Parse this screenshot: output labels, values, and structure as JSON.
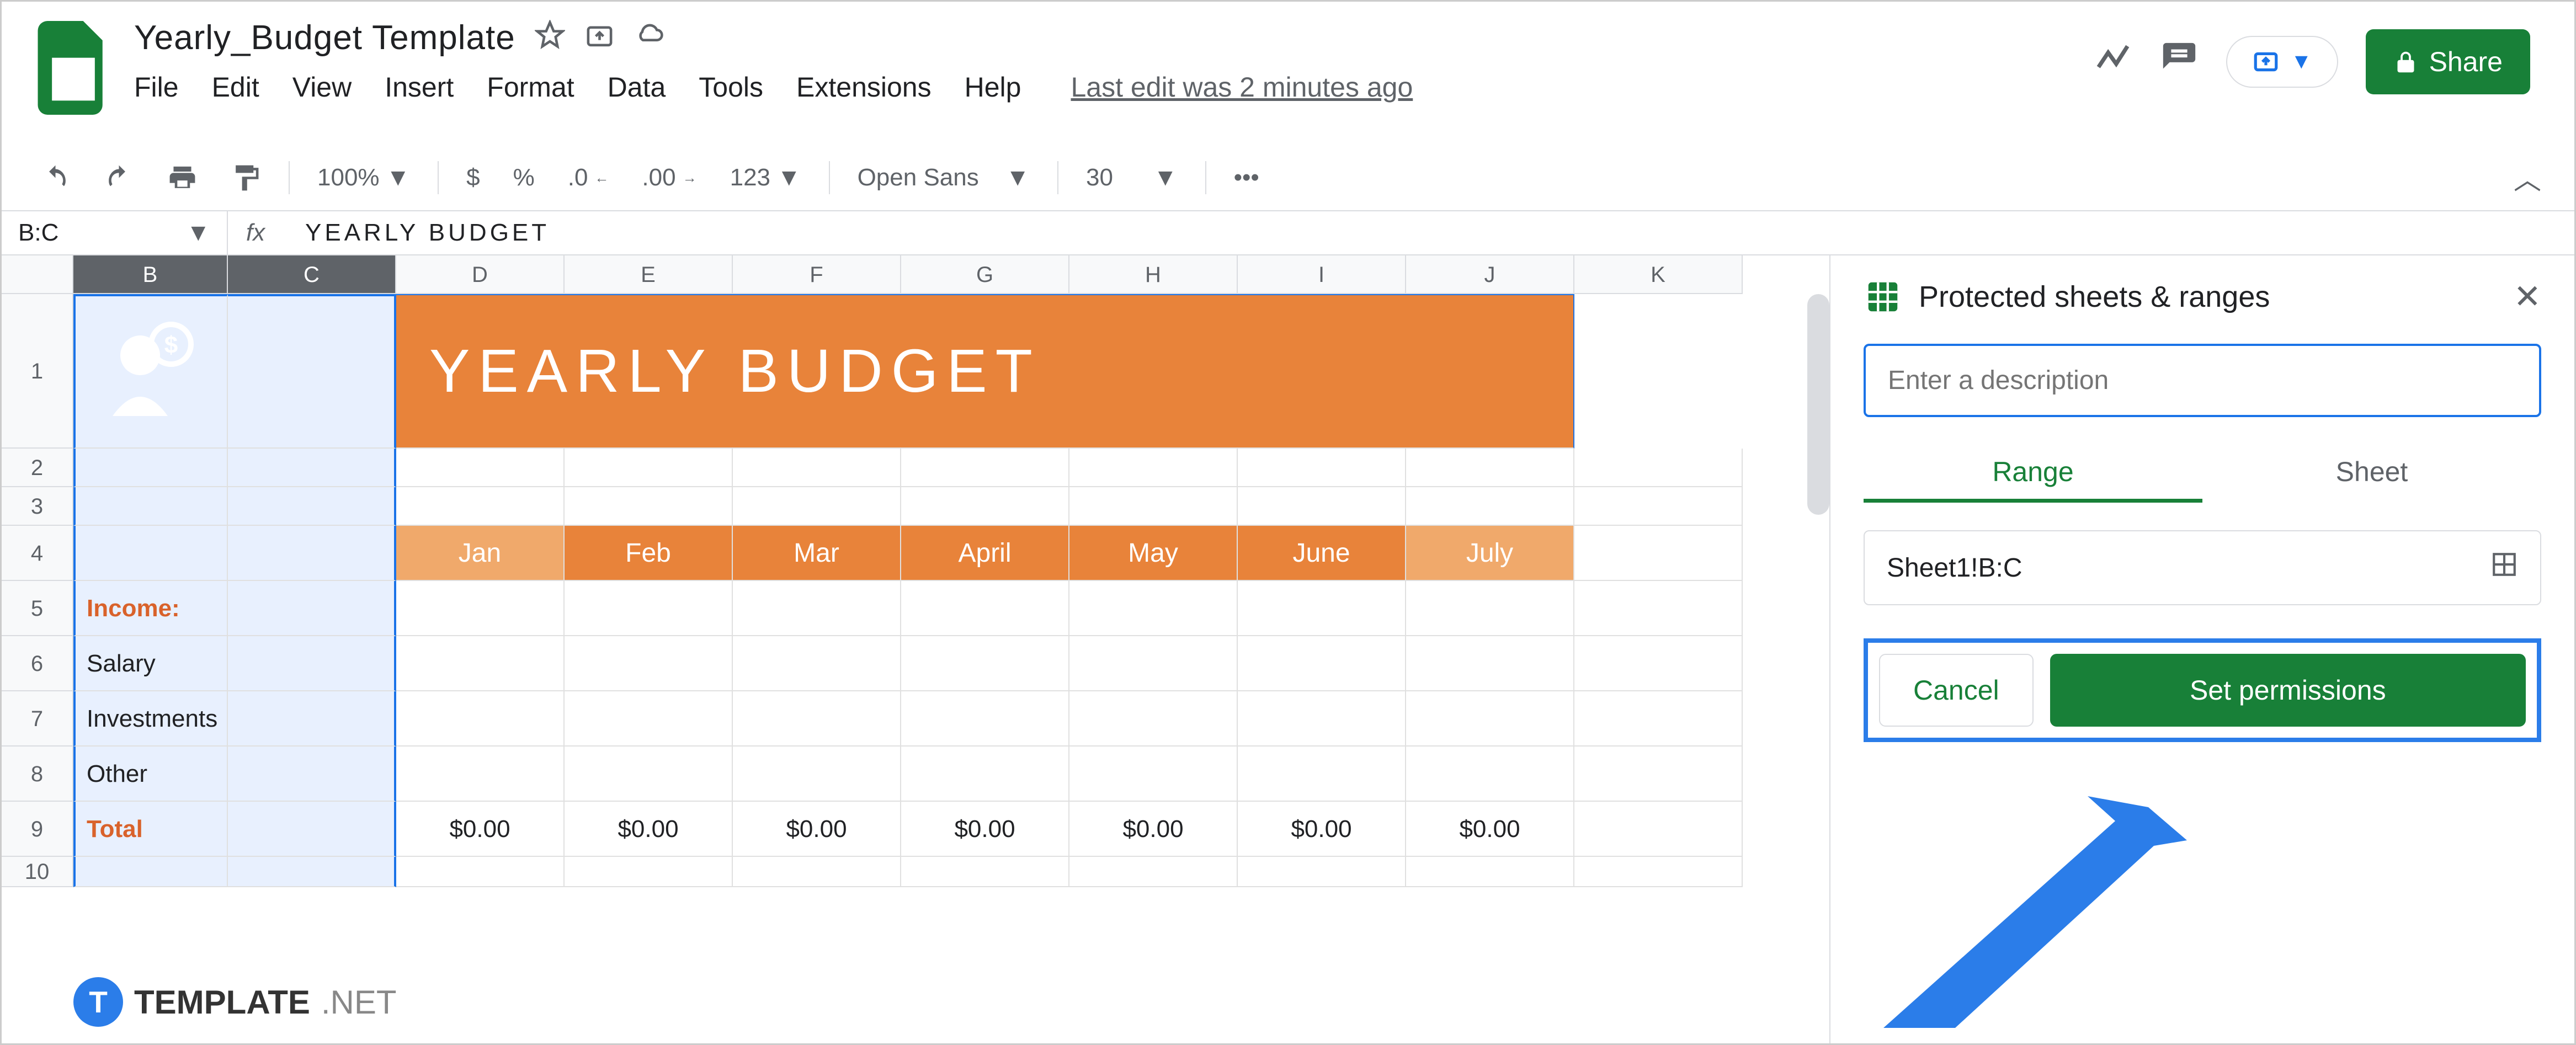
{
  "doc_title": "Yearly_Budget Template",
  "menus": [
    "File",
    "Edit",
    "View",
    "Insert",
    "Format",
    "Data",
    "Tools",
    "Extensions",
    "Help"
  ],
  "last_edit": "Last edit was 2 minutes ago",
  "share_label": "Share",
  "toolbar": {
    "zoom": "100%",
    "currency": "$",
    "percent": "%",
    "dec_dec": ".0",
    "dec_inc": ".00",
    "num_fmt": "123",
    "font": "Open Sans",
    "font_size": "30",
    "more": "•••"
  },
  "name_box": "B:C",
  "formula": "YEARLY  BUDGET",
  "columns": [
    "B",
    "C",
    "D",
    "E",
    "F",
    "G",
    "H",
    "I",
    "J",
    "K"
  ],
  "rows": [
    "1",
    "2",
    "3",
    "4",
    "5",
    "6",
    "7",
    "8",
    "9",
    "10"
  ],
  "banner_text": "YEARLY  BUDGET",
  "months": [
    "Jan",
    "Feb",
    "Mar",
    "April",
    "May",
    "June",
    "July"
  ],
  "labels": {
    "income": "Income:",
    "salary": "Salary",
    "investments": "Investments",
    "other": "Other",
    "total": "Total"
  },
  "totals": [
    "$0.00",
    "$0.00",
    "$0.00",
    "$0.00",
    "$0.00",
    "$0.00",
    "$0.00"
  ],
  "sidebar": {
    "title": "Protected sheets & ranges",
    "desc_placeholder": "Enter a description",
    "tab_range": "Range",
    "tab_sheet": "Sheet",
    "range_value": "Sheet1!B:C",
    "cancel": "Cancel",
    "set_perm": "Set permissions"
  },
  "watermark": {
    "brand": "TEMPLATE",
    "suffix": ".NET"
  }
}
